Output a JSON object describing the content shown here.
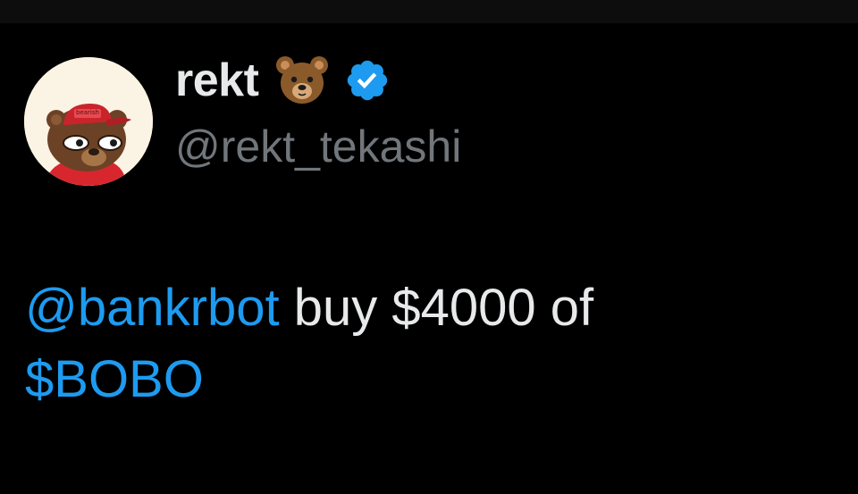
{
  "colors": {
    "background": "#000000",
    "text": "#e7e9ea",
    "secondary_text": "#71767b",
    "link": "#1d9bf0",
    "verified_badge": "#1d9bf0"
  },
  "author": {
    "display_name": "rekt",
    "name_emoji": "bear-face-emoji",
    "verified_icon": "verified-badge-icon",
    "handle": "@rekt_tekashi",
    "avatar_cap_text": "bearish"
  },
  "tweet": {
    "mention": "@bankrbot",
    "text_middle": " buy $4000 of",
    "cashtag": "$BOBO"
  }
}
